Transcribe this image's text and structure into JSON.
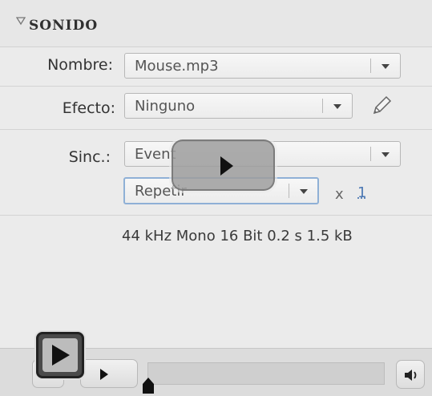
{
  "section": {
    "title": "SONIDO"
  },
  "fields": {
    "name": {
      "label": "Nombre:",
      "value": "Mouse.mp3"
    },
    "effect": {
      "label": "Efecto:",
      "value": "Ninguno"
    },
    "sync": {
      "label": "Sinc.:",
      "value": "Event"
    },
    "repeat": {
      "value": "Repetir",
      "times_symbol": "x",
      "count": "1"
    }
  },
  "sound_info": "44 kHz Mono 16 Bit 0.2 s 1.5 kB",
  "icons": {
    "section_toggle": "triangle-down-icon",
    "dropdown": "chevron-down-icon",
    "edit": "pencil-icon",
    "play": "play-icon",
    "stop": "stop-icon",
    "speaker": "speaker-icon",
    "playhead": "playhead-icon"
  },
  "colors": {
    "link": "#4d79b4",
    "focus": "#8fb0d6"
  }
}
